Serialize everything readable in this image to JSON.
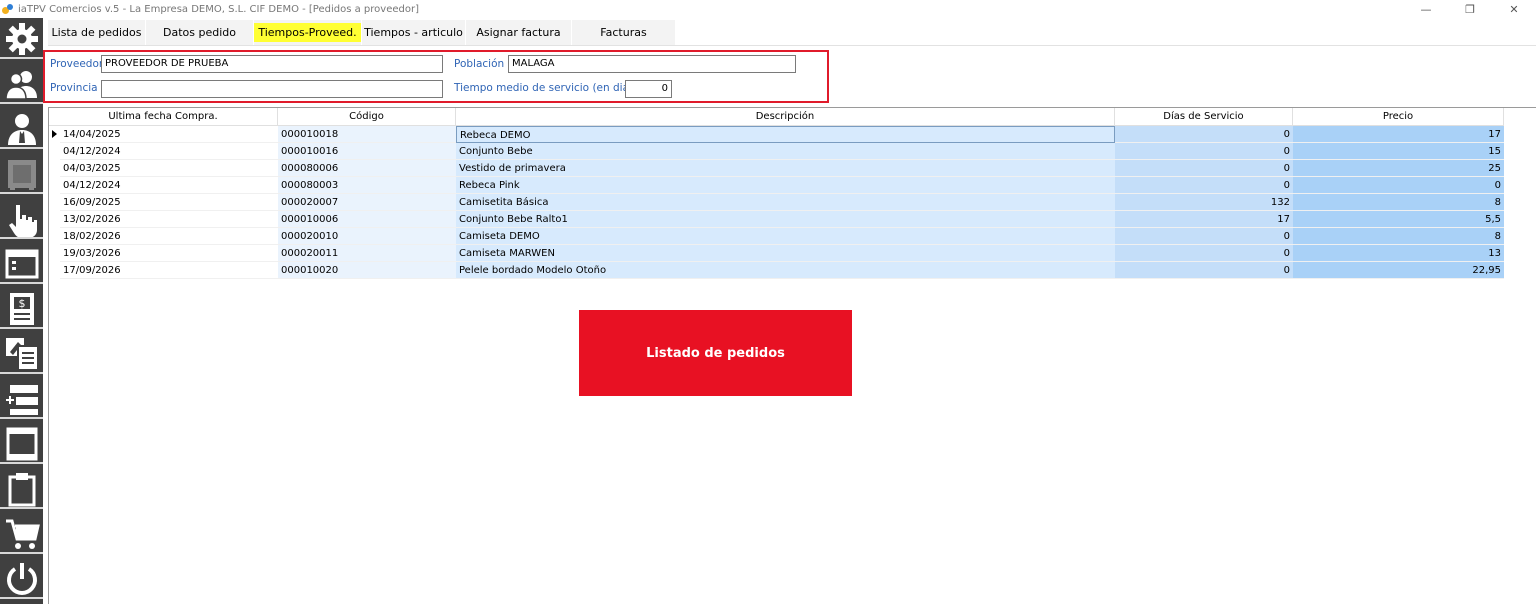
{
  "window": {
    "title": "iaTPV Comercios v.5 - La Empresa DEMO, S.L. CIF DEMO - [Pedidos a proveedor]",
    "minimize_glyph": "—",
    "restore_glyph": "❐",
    "close_glyph": "✕"
  },
  "toolbar": {
    "icons": [
      "gear-icon",
      "users-icon",
      "user-icon",
      "safe-icon",
      "hand-pointer-icon",
      "browser-window-icon",
      "invoice-dollar-icon",
      "documents-clipboard-icon",
      "add-list-icon",
      "window-list-icon",
      "clipboard-icon",
      "shopping-cart-icon",
      "power-icon"
    ]
  },
  "tabs": [
    {
      "label": "Lista de pedidos",
      "active": false
    },
    {
      "label": "Datos pedido",
      "active": false
    },
    {
      "label": "Tiempos-Proveed.",
      "active": true
    },
    {
      "label": "Tiempos - articulo",
      "active": false
    },
    {
      "label": "Asignar factura",
      "active": false
    },
    {
      "label": "Facturas",
      "active": false
    }
  ],
  "form": {
    "proveedor_label": "Proveedor",
    "proveedor_value": "PROVEEDOR DE PRUEBA",
    "poblacion_label": "Población",
    "poblacion_value": "MALAGA",
    "provincia_label": "Provincia",
    "provincia_value": "",
    "tiempo_label": "Tiempo medio de servicio (en dias)",
    "tiempo_value": "0"
  },
  "table": {
    "columns": [
      "Ultima fecha Compra.",
      "Código",
      "Descripción",
      "Días de Servicio",
      "Precio"
    ],
    "rows": [
      {
        "fecha": "14/04/2025",
        "codigo": "000010018",
        "descripcion": "Rebeca DEMO",
        "dias": "0",
        "precio": "17"
      },
      {
        "fecha": "04/12/2024",
        "codigo": "000010016",
        "descripcion": "Conjunto Bebe",
        "dias": "0",
        "precio": "15"
      },
      {
        "fecha": "04/03/2025",
        "codigo": "000080006",
        "descripcion": "Vestido de primavera",
        "dias": "0",
        "precio": "25"
      },
      {
        "fecha": "04/12/2024",
        "codigo": "000080003",
        "descripcion": "Rebeca Pink",
        "dias": "0",
        "precio": "0"
      },
      {
        "fecha": "16/09/2025",
        "codigo": "000020007",
        "descripcion": "Camisetita Básica",
        "dias": "132",
        "precio": "8"
      },
      {
        "fecha": "13/02/2026",
        "codigo": "000010006",
        "descripcion": "Conjunto Bebe Ralto1",
        "dias": "17",
        "precio": "5,5"
      },
      {
        "fecha": "18/02/2026",
        "codigo": "000020010",
        "descripcion": "Camiseta DEMO",
        "dias": "0",
        "precio": "8"
      },
      {
        "fecha": "19/03/2026",
        "codigo": "000020011",
        "descripcion": "Camiseta MARWEN",
        "dias": "0",
        "precio": "13"
      },
      {
        "fecha": "17/09/2026",
        "codigo": "000010020",
        "descripcion": "Pelele bordado Modelo Otoño",
        "dias": "0",
        "precio": "22,95"
      }
    ]
  },
  "banner": {
    "label": "Listado de pedidos"
  },
  "colors": {
    "accent_red": "#e81123",
    "form_border": "#e01b2b",
    "label_blue": "#2f64b5",
    "active_tab": "#ffff33",
    "toolbar": "#404040"
  }
}
